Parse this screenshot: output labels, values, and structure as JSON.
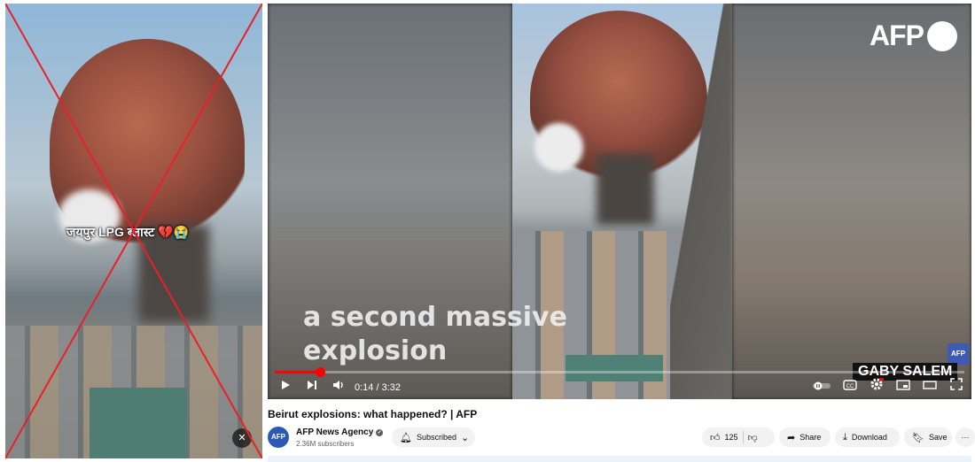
{
  "left_panel": {
    "caption": "जयपुर LPG ब्लास्ट 💔😭",
    "mute_icon": "muted-speaker-icon",
    "cross_color": "#e8202a"
  },
  "player": {
    "brand_logo": "AFP",
    "overlay_text_line1": "a second massive",
    "overlay_text_line2": "explosion",
    "credit": "GABY SALEM",
    "badge": "AFP",
    "time": "0:14 / 3:32",
    "progress": 0.066,
    "progress_color": "#ff0000",
    "icons": {
      "play": "play-icon",
      "next": "next-icon",
      "volume": "volume-icon",
      "autoplay": "autoplay-toggle-icon",
      "captions": "captions-icon",
      "settings": "settings-gear-icon",
      "miniplayer": "miniplayer-icon",
      "theater": "theater-mode-icon",
      "fullscreen": "fullscreen-icon"
    }
  },
  "video": {
    "title": "Beirut explosions: what happened? | AFP",
    "channel": {
      "avatar": "AFP",
      "name": "AFP News Agency",
      "subscribers": "2.36M subscribers"
    },
    "subscribe_label": "Subscribed",
    "likes": "125",
    "share_label": "Share",
    "download_label": "Download",
    "save_label": "Save",
    "more_label": "···"
  }
}
